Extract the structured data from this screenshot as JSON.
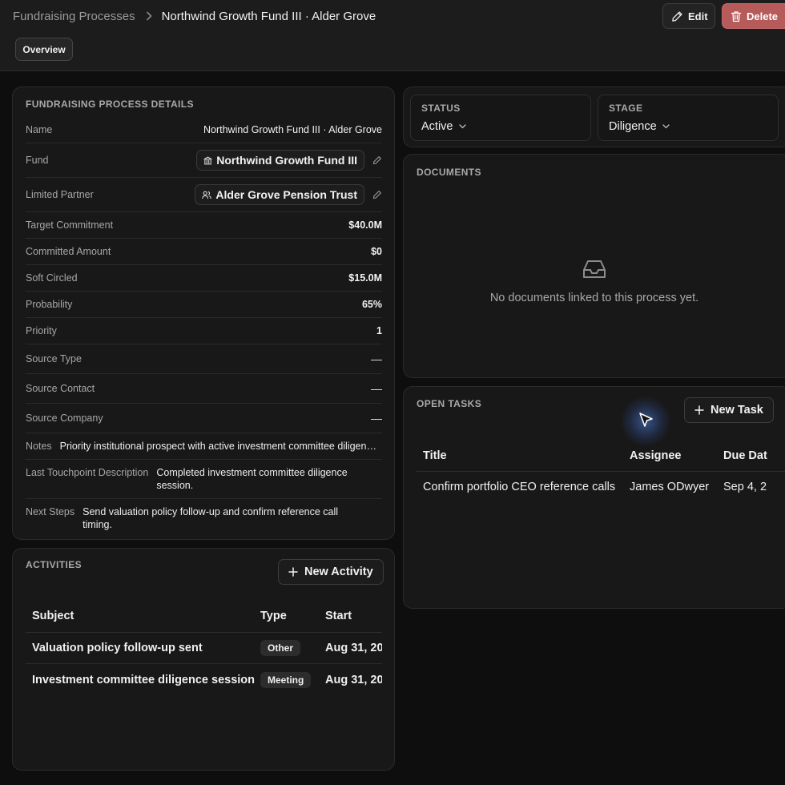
{
  "header": {
    "breadcrumb_root": "Fundraising Processes",
    "breadcrumb_current": "Northwind Growth Fund III · Alder Grove",
    "edit_label": "Edit",
    "delete_label": "Delete",
    "tab_overview": "Overview"
  },
  "details": {
    "title": "FUNDRAISING PROCESS DETAILS",
    "name_label": "Name",
    "name_value": "Northwind Growth Fund III · Alder Grove",
    "fund_label": "Fund",
    "fund_value": "Northwind Growth Fund III",
    "lp_label": "Limited Partner",
    "lp_value": "Alder Grove Pension Trust",
    "target_label": "Target Commitment",
    "target_value": "$40.0M",
    "committed_label": "Committed Amount",
    "committed_value": "$0",
    "soft_label": "Soft Circled",
    "soft_value": "$15.0M",
    "probability_label": "Probability",
    "probability_value": "65%",
    "priority_label": "Priority",
    "priority_value": "1",
    "source_type_label": "Source Type",
    "source_type_value": "—",
    "source_contact_label": "Source Contact",
    "source_contact_value": "—",
    "source_company_label": "Source Company",
    "source_company_value": "—",
    "notes_label": "Notes",
    "notes_value": "Priority institutional prospect with active investment committee diligence.",
    "touchpoint_label": "Last Touchpoint Description",
    "touchpoint_value": "Completed investment committee diligence session.",
    "next_steps_label": "Next Steps",
    "next_steps_value": "Send valuation policy follow-up and confirm reference call timing."
  },
  "status": {
    "status_label": "STATUS",
    "status_value": "Active",
    "stage_label": "STAGE",
    "stage_value": "Diligence"
  },
  "documents": {
    "title": "DOCUMENTS",
    "empty_text": "No documents linked to this process yet."
  },
  "tasks": {
    "title": "OPEN TASKS",
    "new_label": "New Task",
    "columns": [
      "Title",
      "Assignee",
      "Due Dat"
    ],
    "rows": [
      {
        "title": "Confirm portfolio CEO reference calls",
        "assignee": "James ODwyer",
        "due": "Sep 4, 2"
      }
    ]
  },
  "activities": {
    "title": "ACTIVITIES",
    "new_label": "New Activity",
    "columns": [
      "Subject",
      "Type",
      "Start"
    ],
    "rows": [
      {
        "subject": "Valuation policy follow-up sent",
        "type": "Other",
        "start": "Aug 31, 20"
      },
      {
        "subject": "Investment committee diligence session",
        "type": "Meeting",
        "start": "Aug 31, 20"
      }
    ]
  },
  "colors": {
    "background": "#0e0e0e",
    "card": "#181818",
    "delete_button": "#b65a5a",
    "cursor_glow": "#5082e6"
  },
  "icons": {
    "edit": "pencil-icon",
    "delete": "trash-icon",
    "fund": "bank-icon",
    "lp": "users-icon",
    "empty": "inbox-icon",
    "add": "plus-icon"
  }
}
